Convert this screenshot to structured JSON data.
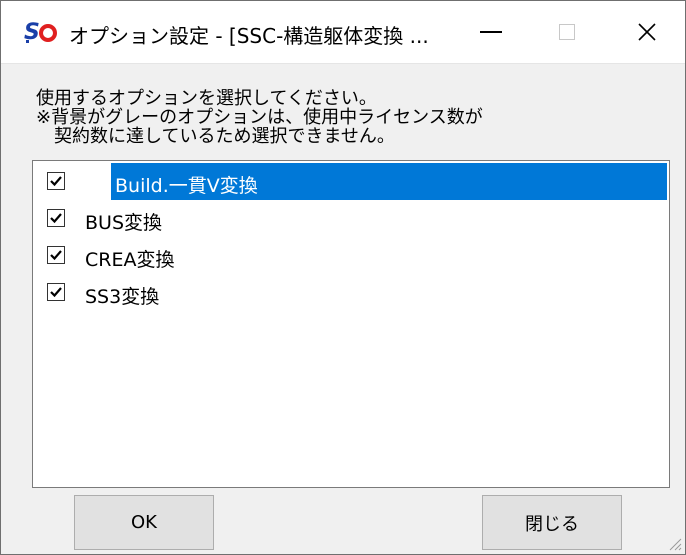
{
  "window": {
    "title": "オプション設定 - [SSC-構造躯体変換 ...",
    "app_icon_text": "Sc",
    "minimize_icon": "minimize-icon",
    "maximize_icon": "maximize-icon",
    "close_icon": "close-icon",
    "close_glyph": "✕"
  },
  "description": {
    "line1": "使用するオプションを選択してください。",
    "line2": "※背景がグレーのオプションは、使用中ライセンス数が",
    "line3": "　契約数に達しているため選択できません。"
  },
  "options": [
    {
      "label": "Build.一貫Ⅴ変換",
      "checked": true,
      "selected": true
    },
    {
      "label": "BUS変換",
      "checked": true,
      "selected": false
    },
    {
      "label": "CREA変換",
      "checked": true,
      "selected": false
    },
    {
      "label": "SS3変換",
      "checked": true,
      "selected": false
    }
  ],
  "buttons": {
    "ok_label": "OK",
    "close_label": "閉じる"
  },
  "colors": {
    "selection": "#0078d7",
    "dialog_bg": "#f0f0f0",
    "icon_blue": "#1a3fa8",
    "icon_red": "#e02020"
  }
}
